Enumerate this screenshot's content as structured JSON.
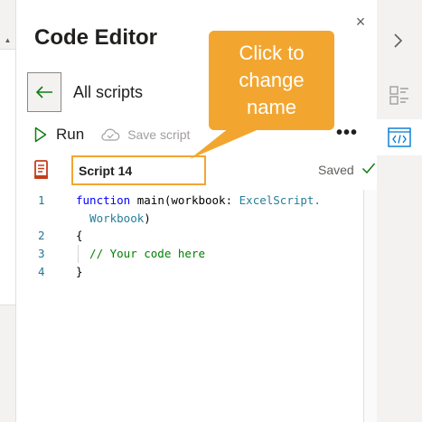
{
  "panel": {
    "title": "Code Editor",
    "close_glyph": "×"
  },
  "nav": {
    "back_icon": "arrow-left-icon",
    "all_scripts_label": "All scripts"
  },
  "toolbar": {
    "run_label": "Run",
    "save_label": "Save script",
    "more_glyph": "•••"
  },
  "script": {
    "name": "Script 14",
    "status": "Saved"
  },
  "editor": {
    "lines": [
      {
        "number": "1",
        "tokens": [
          {
            "t": "function",
            "c": "kw"
          },
          {
            "t": " main(workbook: ",
            "c": "pl"
          },
          {
            "t": "ExcelScript.",
            "c": "ty"
          }
        ]
      },
      {
        "number": "",
        "tokens": [
          {
            "t": "  Workbook",
            "c": "ty"
          },
          {
            "t": ")",
            "c": "pl"
          }
        ]
      },
      {
        "number": "2",
        "tokens": [
          {
            "t": "{",
            "c": "pl"
          }
        ]
      },
      {
        "number": "3",
        "tokens": [
          {
            "t": "  // Your code here",
            "c": "cm"
          }
        ]
      },
      {
        "number": "4",
        "tokens": [
          {
            "t": "}",
            "c": "pl"
          }
        ]
      }
    ]
  },
  "callout": {
    "text": "Click to\nchange\nname"
  },
  "colors": {
    "accent": "#f2a630",
    "run_green": "#107c10",
    "script_icon_red": "#c43e1c"
  }
}
